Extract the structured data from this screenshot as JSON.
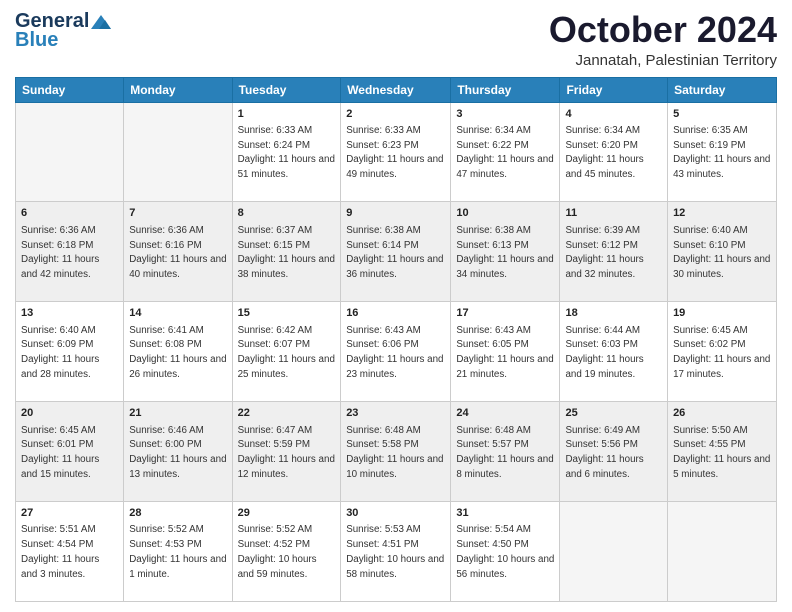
{
  "header": {
    "logo": {
      "general": "General",
      "blue": "Blue"
    },
    "title": "October 2024",
    "location": "Jannatah, Palestinian Territory"
  },
  "calendar": {
    "days": [
      "Sunday",
      "Monday",
      "Tuesday",
      "Wednesday",
      "Thursday",
      "Friday",
      "Saturday"
    ],
    "weeks": [
      [
        {
          "day": "",
          "info": ""
        },
        {
          "day": "",
          "info": ""
        },
        {
          "day": "1",
          "info": "Sunrise: 6:33 AM\nSunset: 6:24 PM\nDaylight: 11 hours and 51 minutes."
        },
        {
          "day": "2",
          "info": "Sunrise: 6:33 AM\nSunset: 6:23 PM\nDaylight: 11 hours and 49 minutes."
        },
        {
          "day": "3",
          "info": "Sunrise: 6:34 AM\nSunset: 6:22 PM\nDaylight: 11 hours and 47 minutes."
        },
        {
          "day": "4",
          "info": "Sunrise: 6:34 AM\nSunset: 6:20 PM\nDaylight: 11 hours and 45 minutes."
        },
        {
          "day": "5",
          "info": "Sunrise: 6:35 AM\nSunset: 6:19 PM\nDaylight: 11 hours and 43 minutes."
        }
      ],
      [
        {
          "day": "6",
          "info": "Sunrise: 6:36 AM\nSunset: 6:18 PM\nDaylight: 11 hours and 42 minutes."
        },
        {
          "day": "7",
          "info": "Sunrise: 6:36 AM\nSunset: 6:16 PM\nDaylight: 11 hours and 40 minutes."
        },
        {
          "day": "8",
          "info": "Sunrise: 6:37 AM\nSunset: 6:15 PM\nDaylight: 11 hours and 38 minutes."
        },
        {
          "day": "9",
          "info": "Sunrise: 6:38 AM\nSunset: 6:14 PM\nDaylight: 11 hours and 36 minutes."
        },
        {
          "day": "10",
          "info": "Sunrise: 6:38 AM\nSunset: 6:13 PM\nDaylight: 11 hours and 34 minutes."
        },
        {
          "day": "11",
          "info": "Sunrise: 6:39 AM\nSunset: 6:12 PM\nDaylight: 11 hours and 32 minutes."
        },
        {
          "day": "12",
          "info": "Sunrise: 6:40 AM\nSunset: 6:10 PM\nDaylight: 11 hours and 30 minutes."
        }
      ],
      [
        {
          "day": "13",
          "info": "Sunrise: 6:40 AM\nSunset: 6:09 PM\nDaylight: 11 hours and 28 minutes."
        },
        {
          "day": "14",
          "info": "Sunrise: 6:41 AM\nSunset: 6:08 PM\nDaylight: 11 hours and 26 minutes."
        },
        {
          "day": "15",
          "info": "Sunrise: 6:42 AM\nSunset: 6:07 PM\nDaylight: 11 hours and 25 minutes."
        },
        {
          "day": "16",
          "info": "Sunrise: 6:43 AM\nSunset: 6:06 PM\nDaylight: 11 hours and 23 minutes."
        },
        {
          "day": "17",
          "info": "Sunrise: 6:43 AM\nSunset: 6:05 PM\nDaylight: 11 hours and 21 minutes."
        },
        {
          "day": "18",
          "info": "Sunrise: 6:44 AM\nSunset: 6:03 PM\nDaylight: 11 hours and 19 minutes."
        },
        {
          "day": "19",
          "info": "Sunrise: 6:45 AM\nSunset: 6:02 PM\nDaylight: 11 hours and 17 minutes."
        }
      ],
      [
        {
          "day": "20",
          "info": "Sunrise: 6:45 AM\nSunset: 6:01 PM\nDaylight: 11 hours and 15 minutes."
        },
        {
          "day": "21",
          "info": "Sunrise: 6:46 AM\nSunset: 6:00 PM\nDaylight: 11 hours and 13 minutes."
        },
        {
          "day": "22",
          "info": "Sunrise: 6:47 AM\nSunset: 5:59 PM\nDaylight: 11 hours and 12 minutes."
        },
        {
          "day": "23",
          "info": "Sunrise: 6:48 AM\nSunset: 5:58 PM\nDaylight: 11 hours and 10 minutes."
        },
        {
          "day": "24",
          "info": "Sunrise: 6:48 AM\nSunset: 5:57 PM\nDaylight: 11 hours and 8 minutes."
        },
        {
          "day": "25",
          "info": "Sunrise: 6:49 AM\nSunset: 5:56 PM\nDaylight: 11 hours and 6 minutes."
        },
        {
          "day": "26",
          "info": "Sunrise: 5:50 AM\nSunset: 4:55 PM\nDaylight: 11 hours and 5 minutes."
        }
      ],
      [
        {
          "day": "27",
          "info": "Sunrise: 5:51 AM\nSunset: 4:54 PM\nDaylight: 11 hours and 3 minutes."
        },
        {
          "day": "28",
          "info": "Sunrise: 5:52 AM\nSunset: 4:53 PM\nDaylight: 11 hours and 1 minute."
        },
        {
          "day": "29",
          "info": "Sunrise: 5:52 AM\nSunset: 4:52 PM\nDaylight: 10 hours and 59 minutes."
        },
        {
          "day": "30",
          "info": "Sunrise: 5:53 AM\nSunset: 4:51 PM\nDaylight: 10 hours and 58 minutes."
        },
        {
          "day": "31",
          "info": "Sunrise: 5:54 AM\nSunset: 4:50 PM\nDaylight: 10 hours and 56 minutes."
        },
        {
          "day": "",
          "info": ""
        },
        {
          "day": "",
          "info": ""
        }
      ]
    ]
  }
}
